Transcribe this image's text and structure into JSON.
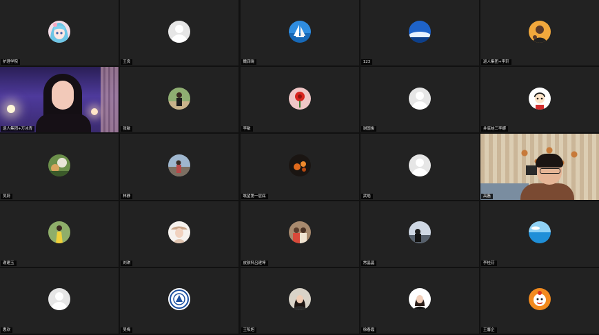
{
  "participants": [
    {
      "name": "护理学院",
      "avatar": "anime-girl"
    },
    {
      "name": "王良",
      "avatar": "default"
    },
    {
      "name": "魏润晓",
      "avatar": "sailboat"
    },
    {
      "name": "123",
      "avatar": "sky"
    },
    {
      "name": "巡人集团+李轩",
      "avatar": "man-cartoon"
    },
    {
      "name": "巡人集团+万冰青",
      "avatar": "video"
    },
    {
      "name": "张敏",
      "avatar": "outdoor-person"
    },
    {
      "name": "李敏",
      "avatar": "red-flower"
    },
    {
      "name": "谢国俊",
      "avatar": "default"
    },
    {
      "name": "井底蛙三李娜",
      "avatar": "cartoon-boy"
    },
    {
      "name": "吴蔚",
      "avatar": "flower-photo"
    },
    {
      "name": "林静",
      "avatar": "street-photo"
    },
    {
      "name": "眺望第一层底",
      "avatar": "dark-orange"
    },
    {
      "name": "武皓",
      "avatar": "default"
    },
    {
      "name": "高磊",
      "avatar": "video-office",
      "active": true
    },
    {
      "name": "谢建玉",
      "avatar": "yellow-dress"
    },
    {
      "name": "刘琪",
      "avatar": "woman-hat"
    },
    {
      "name": "皮肤科吕建坤",
      "avatar": "group-photo"
    },
    {
      "name": "常晶晶",
      "avatar": "scenery-dark"
    },
    {
      "name": "李桂芬",
      "avatar": "sea"
    },
    {
      "name": "惠欣",
      "avatar": "default"
    },
    {
      "name": "吴梅",
      "avatar": "emblem"
    },
    {
      "name": "王阳旭",
      "avatar": "woman-dark"
    },
    {
      "name": "徐春霞",
      "avatar": "woman-white"
    },
    {
      "name": "王馨企",
      "avatar": "orange-cartoon"
    }
  ],
  "colors": {
    "tile_bg": "#222222",
    "active_border": "#3fbf5a",
    "label_bg": "#000000",
    "label_text": "#e8e8e8"
  }
}
